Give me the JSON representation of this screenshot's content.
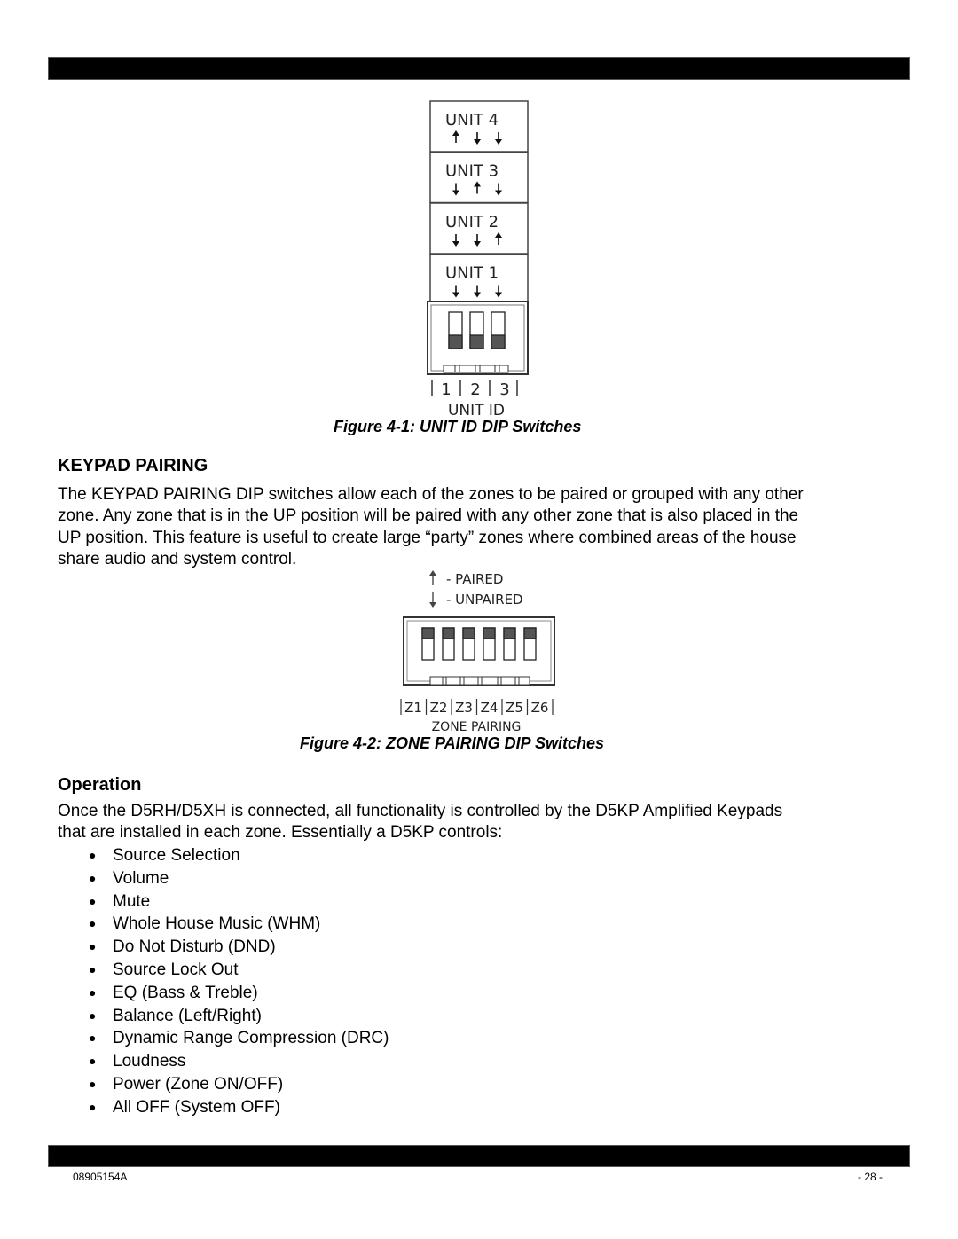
{
  "header": {},
  "figure1": {
    "units": [
      {
        "label": "UNIT 4",
        "switches": [
          "up",
          "down",
          "down"
        ]
      },
      {
        "label": "UNIT 3",
        "switches": [
          "down",
          "up",
          "down"
        ]
      },
      {
        "label": "UNIT 2",
        "switches": [
          "down",
          "down",
          "up"
        ]
      },
      {
        "label": "UNIT 1",
        "switches": [
          "down",
          "down",
          "down"
        ]
      }
    ],
    "switch_numbers": [
      "1",
      "2",
      "3"
    ],
    "switch_label": "UNIT ID",
    "caption": "Figure 4-1: UNIT ID DIP Switches"
  },
  "keypad_pairing": {
    "heading": "KEYPAD PAIRING",
    "paragraph_lines": [
      "The KEYPAD PAIRING DIP switches allow each of the zones to be paired or grouped with any other",
      "zone. Any zone that is in the UP position will be paired with any other zone that is also placed in the",
      "UP position. This feature is useful to create large “party” zones where combined areas of the house",
      "share audio and system control."
    ]
  },
  "figure2": {
    "legend": [
      {
        "arrow": "up",
        "text": "-  PAIRED"
      },
      {
        "arrow": "down",
        "text": "-  UNPAIRED"
      }
    ],
    "zones": [
      "Z1",
      "Z2",
      "Z3",
      "Z4",
      "Z5",
      "Z6"
    ],
    "switch_label": "ZONE PAIRING",
    "caption": "Figure 4-2: ZONE PAIRING DIP Switches"
  },
  "operation": {
    "heading": "Operation",
    "paragraph_lines": [
      "Once the D5RH/D5XH is connected, all functionality is controlled by the D5KP Amplified Keypads",
      "that are installed in each zone. Essentially a D5KP controls:"
    ],
    "bullet_glyph": "●",
    "items": [
      "Source Selection",
      "Volume",
      "Mute",
      "Whole House Music (WHM)",
      "Do Not Disturb (DND)",
      "Source Lock Out",
      "EQ (Bass & Treble)",
      "Balance (Left/Right)",
      "Dynamic Range Compression (DRC)",
      "Loudness",
      "Power (Zone ON/OFF)",
      "All OFF (System OFF)"
    ]
  },
  "footer": {
    "doc_number": "08905154A",
    "page": "- 28 -"
  }
}
